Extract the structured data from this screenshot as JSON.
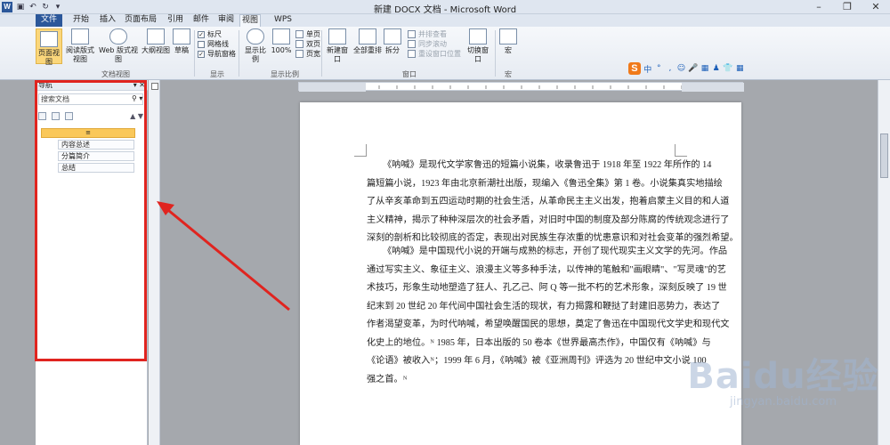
{
  "window": {
    "title": "新建 DOCX 文档 - Microsoft Word"
  },
  "tabs": [
    "文件",
    "开始",
    "插入",
    "页面布局",
    "引用",
    "邮件",
    "审阅",
    "视图",
    "WPS PDF"
  ],
  "ribbon": {
    "doc_views": {
      "print": "页面视图",
      "read": "阅读版式视图",
      "web": "Web 版式视图",
      "outline": "大纲视图",
      "draft": "草稿",
      "group": "文档视图"
    },
    "show": {
      "ruler": "标尺",
      "grid": "网格线",
      "nav": "导航窗格",
      "group": "显示"
    },
    "zoom": {
      "zoom": "显示比例",
      "hundred": "100%",
      "one_page": "单页",
      "two_pages": "双页",
      "page_width": "页宽",
      "group": "显示比例"
    },
    "window": {
      "new": "新建窗口",
      "arrange": "全部重排",
      "split": "拆分",
      "side": "并排查看",
      "sync": "同步滚动",
      "reset": "重设窗口位置",
      "switch": "切换窗口",
      "group": "窗口"
    },
    "macro": {
      "label": "宏",
      "group": "宏"
    }
  },
  "ime": {
    "s": "S",
    "items": [
      "中",
      "°",
      ",",
      "☺",
      "🎤",
      "▦",
      "♟",
      "👕",
      "▦"
    ]
  },
  "nav": {
    "title": "导航",
    "search_placeholder": "搜索文档",
    "highlight": "≡",
    "items": [
      "内容总述",
      "分篇简介",
      "总结"
    ]
  },
  "doc": {
    "p1_lines": [
      "《呐喊》是现代文学家鲁迅的短篇小说集，收录鲁迅于 1918 年至 1922 年所作的 14",
      "篇短篇小说，1923 年由北京新潮社出版，现编入《鲁迅全集》第 1 卷。小说集真实地描绘",
      "了从辛亥革命到五四运动时期的社会生活，从革命民主主义出发，抱着启蒙主义目的和人道",
      "主义精神，揭示了种种深层次的社会矛盾，对旧时中国的制度及部分陈腐的传统观念进行了",
      "深刻的剖析和比较彻底的否定，表现出对民族生存浓重的忧患意识和对社会变革的强烈希望。"
    ],
    "p2_lines": [
      "《呐喊》是中国现代小说的开端与成熟的标志，开创了现代现实主义文学的先河。作品",
      "通过写实主义、象征主义、浪漫主义等多种手法，以传神的笔触和\"画眼睛\"、\"写灵魂\"的艺",
      "术技巧，形象生动地塑造了狂人、孔乙己、阿 Q 等一批不朽的艺术形象，深刻反映了 19 世",
      "纪末到 20 世纪 20 年代间中国社会生活的现状，有力揭露和鞭挞了封建旧恶势力，表达了",
      "作者渴望变革，为时代呐喊，希望唤醒国民的思想，奠定了鲁迅在中国现代文学史和现代文",
      "化史上的地位。ᴺ 1985 年，日本出版的 50 卷本《世界最高杰作》，中国仅有《呐喊》与",
      "《论语》被收入ᴺ；1999 年 6 月，《呐喊》被《亚洲周刊》评选为 20 世纪中文小说 100",
      "强之首。ᴺ"
    ]
  },
  "watermark": {
    "big": "Baidu经验",
    "small": "jingyan.baidu.com"
  }
}
